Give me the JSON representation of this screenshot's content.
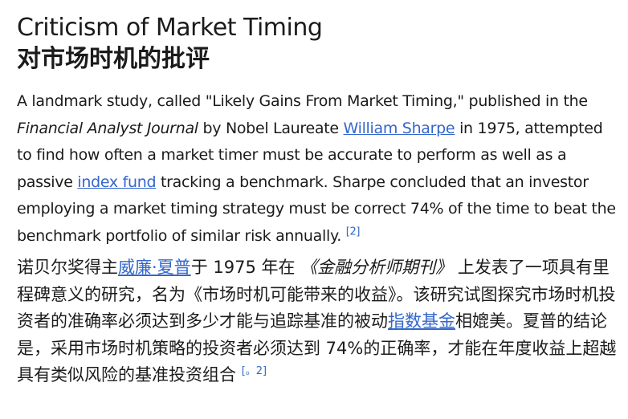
{
  "title_en": "Criticism of Market Timing",
  "title_zh": "对市场时机的批评",
  "para_en": {
    "t1": "A landmark study, called \"Likely Gains From Market Timing,\" published in the ",
    "journal": "Financial Analyst Journal",
    "t2": " by Nobel Laureate ",
    "link_sharpe": "William Sharpe",
    "t3": " in 1975, attempted to find how often a market timer must be accurate to perform as well as a passive ",
    "link_index": "index fund",
    "t4": " tracking a benchmark. Sharpe concluded that an investor employing a market timing strategy must be correct 74% of the time to beat the benchmark portfolio of similar risk annually.",
    "ref": "[2]"
  },
  "para_zh": {
    "t1": "诺贝尔奖得主",
    "link_sharpe": "威廉·夏普",
    "t2": "于 1975 年在 ",
    "journal": "《金融分析师期刊》",
    "t3": " 上发表了一项具有里程碑意义的研究，名为《市场时机可能带来的收益》。该研究试图探究市场时机投资者的准确率必须达到多少才能与追踪基准的被动",
    "link_index": "指数基金",
    "t4": "相媲美。夏普的结论是，采用市场时机策略的投资者必须达到 74%的正确率，才能在年度收益上超越具有类似风险的基准投资组合 ",
    "ref": "[。2]"
  }
}
